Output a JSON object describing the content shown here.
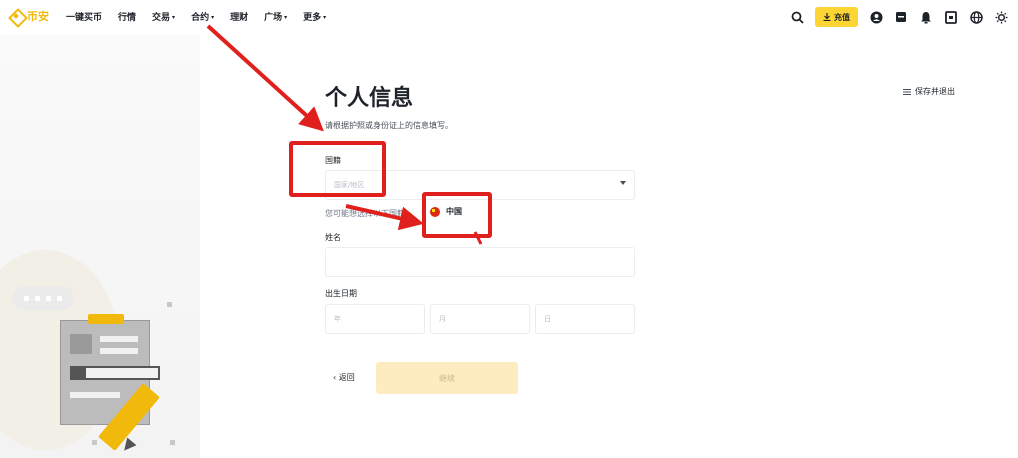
{
  "nav": {
    "logo_text": "币安",
    "items": [
      {
        "label": "一键买币",
        "has_caret": false
      },
      {
        "label": "行情",
        "has_caret": false
      },
      {
        "label": "交易",
        "has_caret": true
      },
      {
        "label": "合约",
        "has_caret": true
      },
      {
        "label": "理财",
        "has_caret": false
      },
      {
        "label": "广场",
        "has_caret": true
      },
      {
        "label": "更多",
        "has_caret": true
      }
    ],
    "caret_glyph": "▾",
    "deposit_label": "充值",
    "right_icons": [
      "search-icon",
      "account-icon",
      "orders-icon",
      "notification-icon",
      "download-icon",
      "language-icon",
      "theme-icon"
    ]
  },
  "page": {
    "title": "个人信息",
    "subtitle": "请根据护照或身份证上的信息填写。",
    "save_exit_label": "保存并退出"
  },
  "form": {
    "nationality_label": "国籍",
    "nationality_placeholder": "国家/地区",
    "hint": "您可能想选择以下国籍",
    "suggested_country": "中国",
    "name_label": "姓名",
    "name_value": "",
    "dob_label": "出生日期",
    "dob_year_placeholder": "年",
    "dob_month_placeholder": "月",
    "dob_day_placeholder": "日",
    "back_label": "‹ 返回",
    "continue_label": "继续"
  },
  "colors": {
    "brand_yellow": "#fcd535",
    "brand_logo": "#f0b90b",
    "annotation_red": "#e0201c"
  }
}
